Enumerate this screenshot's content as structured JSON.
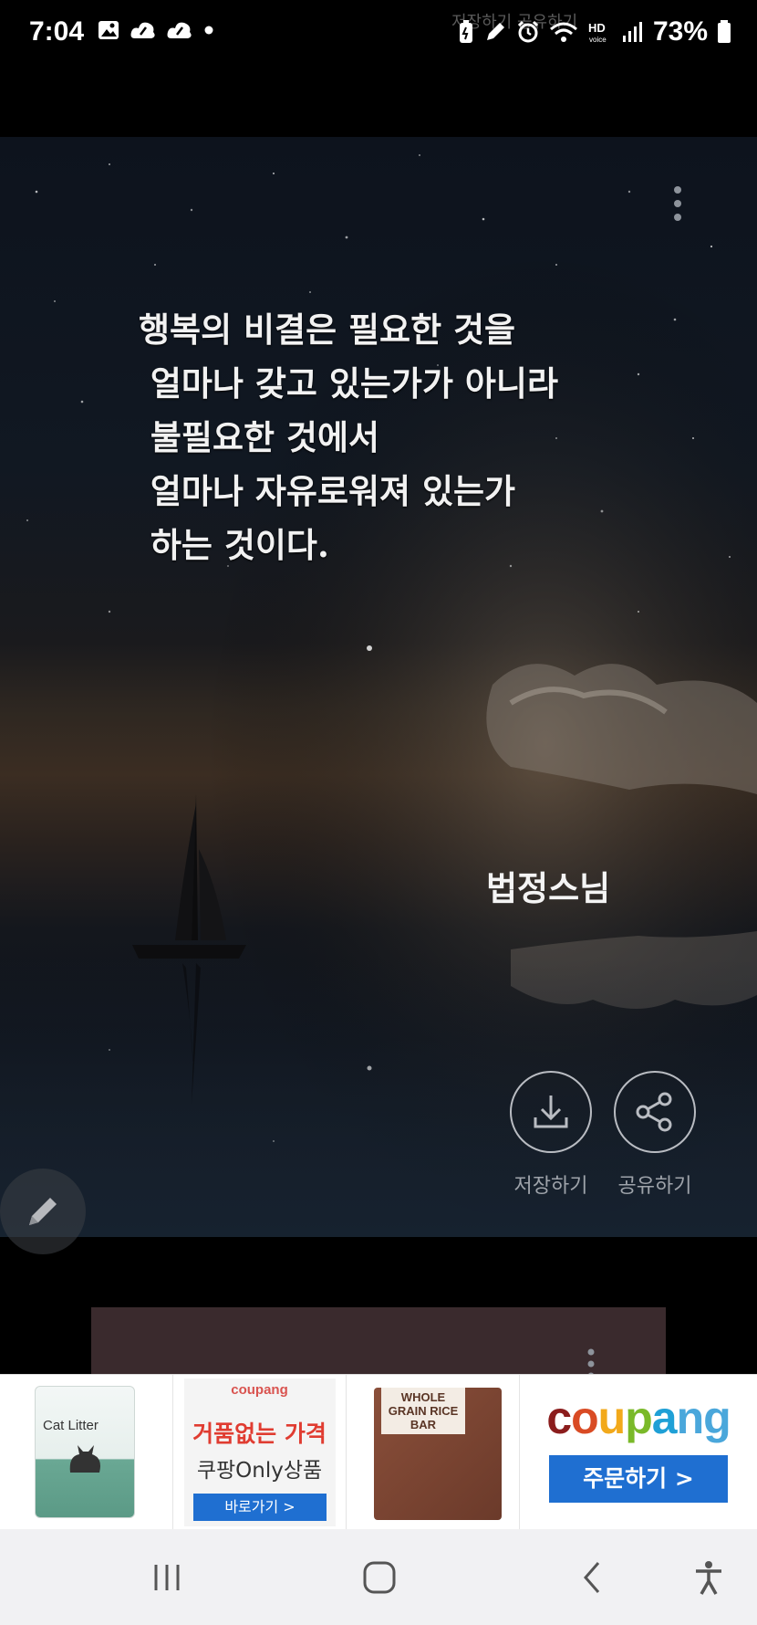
{
  "status_bar": {
    "time": "7:04",
    "battery": "73%",
    "ghost_text": "저장하기 공유하기"
  },
  "card": {
    "quote": "행복의 비결은 필요한 것을\n 얼마나 갖고 있는가가 아니라\n 불필요한 것에서\n 얼마나 자유로워져 있는가\n 하는 것이다.",
    "author": "법정스님",
    "save_label": "저장하기",
    "share_label": "공유하기"
  },
  "ad": {
    "item1_title": "Cat Litter",
    "item2_brand": "coupang",
    "item2_line1": "거품없는 가격",
    "item2_line2": "쿠팡Only상품",
    "item2_button": "바로가기 >",
    "item3_label": "WHOLE GRAIN RICE BAR",
    "logo_parts": [
      "c",
      "o",
      "u",
      "p",
      "a",
      "n",
      "g"
    ],
    "logo_colors": [
      "#8b1d1d",
      "#d94b24",
      "#f2a91b",
      "#7ab929",
      "#1fa0d6",
      "#4aa7db",
      "#4aa7db"
    ],
    "order_button": "주문하기 >"
  },
  "icons": {
    "status_left": [
      "gallery-icon",
      "cloud-icon",
      "cloud-icon",
      "dot-icon"
    ],
    "status_right": [
      "battery-saver-icon",
      "pen-icon",
      "alarm-icon",
      "wifi-icon",
      "hd-voice-icon",
      "signal-icon",
      "battery-icon"
    ],
    "nav": [
      "recent-apps-icon",
      "home-icon",
      "back-icon",
      "accessibility-icon"
    ]
  }
}
